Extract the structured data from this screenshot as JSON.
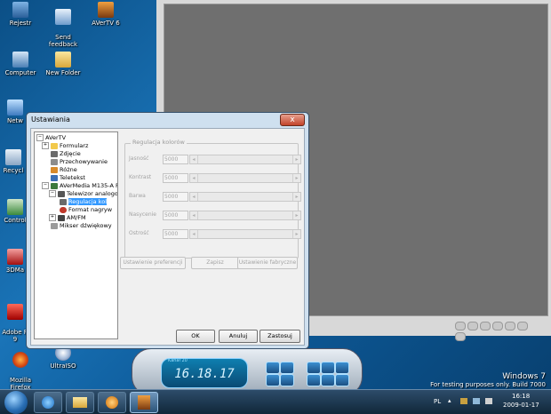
{
  "desktop": {
    "icons": [
      {
        "label": "Rejestr"
      },
      {
        "label": "Send\nfeedback"
      },
      {
        "label": "AVerTV 6"
      },
      {
        "label": "Computer"
      },
      {
        "label": "New Folder"
      },
      {
        "label": "Netw"
      },
      {
        "label": "Recycl"
      },
      {
        "label": "Control"
      },
      {
        "label": "3DMa"
      },
      {
        "label": "Adobe R\n9"
      },
      {
        "label": "Mozilla\nFirefox"
      },
      {
        "label": "UltraISO"
      }
    ]
  },
  "dialog": {
    "title": "Ustawiania",
    "close": "x",
    "tree": [
      {
        "label": "AVerTV",
        "level": 0
      },
      {
        "label": "Formularz",
        "level": 1
      },
      {
        "label": "Zdjęcie",
        "level": 1
      },
      {
        "label": "Przechowywanie",
        "level": 1
      },
      {
        "label": "Różne",
        "level": 1
      },
      {
        "label": "Teletekst",
        "level": 1
      },
      {
        "label": "AVerMedia M135-A PC",
        "level": 1
      },
      {
        "label": "Telewizor analogo",
        "level": 2
      },
      {
        "label": "Regulacja kol",
        "level": 3,
        "selected": true
      },
      {
        "label": "Format nagryw",
        "level": 3
      },
      {
        "label": "AM/FM",
        "level": 2
      },
      {
        "label": "Mikser dźwiękowy",
        "level": 1
      }
    ],
    "group_title": "Regulacja kolorów",
    "rows": [
      {
        "label": "Jasność",
        "value": "5000"
      },
      {
        "label": "Kontrast",
        "value": "5000"
      },
      {
        "label": "Barwa",
        "value": "5000"
      },
      {
        "label": "Nasycenie",
        "value": "5000"
      },
      {
        "label": "Ostrość",
        "value": "5000"
      }
    ],
    "btn_pref": "Ustawienie preferencji",
    "btn_save": "Zapisz",
    "btn_factory": "Ustawienie fabryczne",
    "ok": "OK",
    "cancel": "Anuluj",
    "apply": "Zastosuj"
  },
  "player": {
    "clock": "16.18.17",
    "clock_label": "Kanał 20"
  },
  "watermark": {
    "line1": "Windows 7",
    "line2": "For testing purposes only. Build 7000"
  },
  "tray": {
    "lang": "PL",
    "time": "16:18",
    "date": "2009-01-17"
  }
}
